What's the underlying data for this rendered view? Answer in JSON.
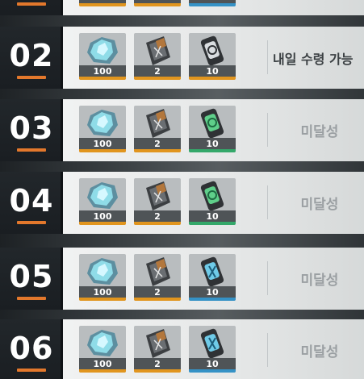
{
  "rows": [
    {
      "day": "02",
      "status": "내일 수령 가능",
      "status_kind": "claimable",
      "items": [
        {
          "icon": "crystal-icon",
          "qty": "100",
          "rarity": "orange"
        },
        {
          "icon": "data-pack-icon",
          "qty": "2",
          "rarity": "orange"
        },
        {
          "icon": "capsule-icon",
          "qty": "10",
          "rarity": "orange"
        }
      ]
    },
    {
      "day": "03",
      "status": "미달성",
      "status_kind": "locked",
      "items": [
        {
          "icon": "crystal-icon",
          "qty": "100",
          "rarity": "orange"
        },
        {
          "icon": "data-pack-icon",
          "qty": "2",
          "rarity": "orange"
        },
        {
          "icon": "capsule-icon",
          "qty": "10",
          "rarity": "green"
        }
      ]
    },
    {
      "day": "04",
      "status": "미달성",
      "status_kind": "locked",
      "items": [
        {
          "icon": "crystal-icon",
          "qty": "100",
          "rarity": "orange"
        },
        {
          "icon": "data-pack-icon",
          "qty": "2",
          "rarity": "orange"
        },
        {
          "icon": "capsule-icon",
          "qty": "10",
          "rarity": "green"
        }
      ]
    },
    {
      "day": "05",
      "status": "미달성",
      "status_kind": "locked",
      "items": [
        {
          "icon": "crystal-icon",
          "qty": "100",
          "rarity": "orange"
        },
        {
          "icon": "data-pack-icon",
          "qty": "2",
          "rarity": "orange"
        },
        {
          "icon": "capsule-icon",
          "qty": "10",
          "rarity": "blue"
        }
      ]
    },
    {
      "day": "06",
      "status": "미달성",
      "status_kind": "locked",
      "items": [
        {
          "icon": "crystal-icon",
          "qty": "100",
          "rarity": "orange"
        },
        {
          "icon": "data-pack-icon",
          "qty": "2",
          "rarity": "orange"
        },
        {
          "icon": "capsule-icon",
          "qty": "10",
          "rarity": "blue"
        }
      ]
    }
  ],
  "colors": {
    "day_accent": "#e3782c",
    "rarity_orange": "#e1951e",
    "rarity_green": "#34a86a",
    "rarity_blue": "#3592c6",
    "status_locked": "#9a9fa2",
    "status_claimable": "#3b4043"
  }
}
